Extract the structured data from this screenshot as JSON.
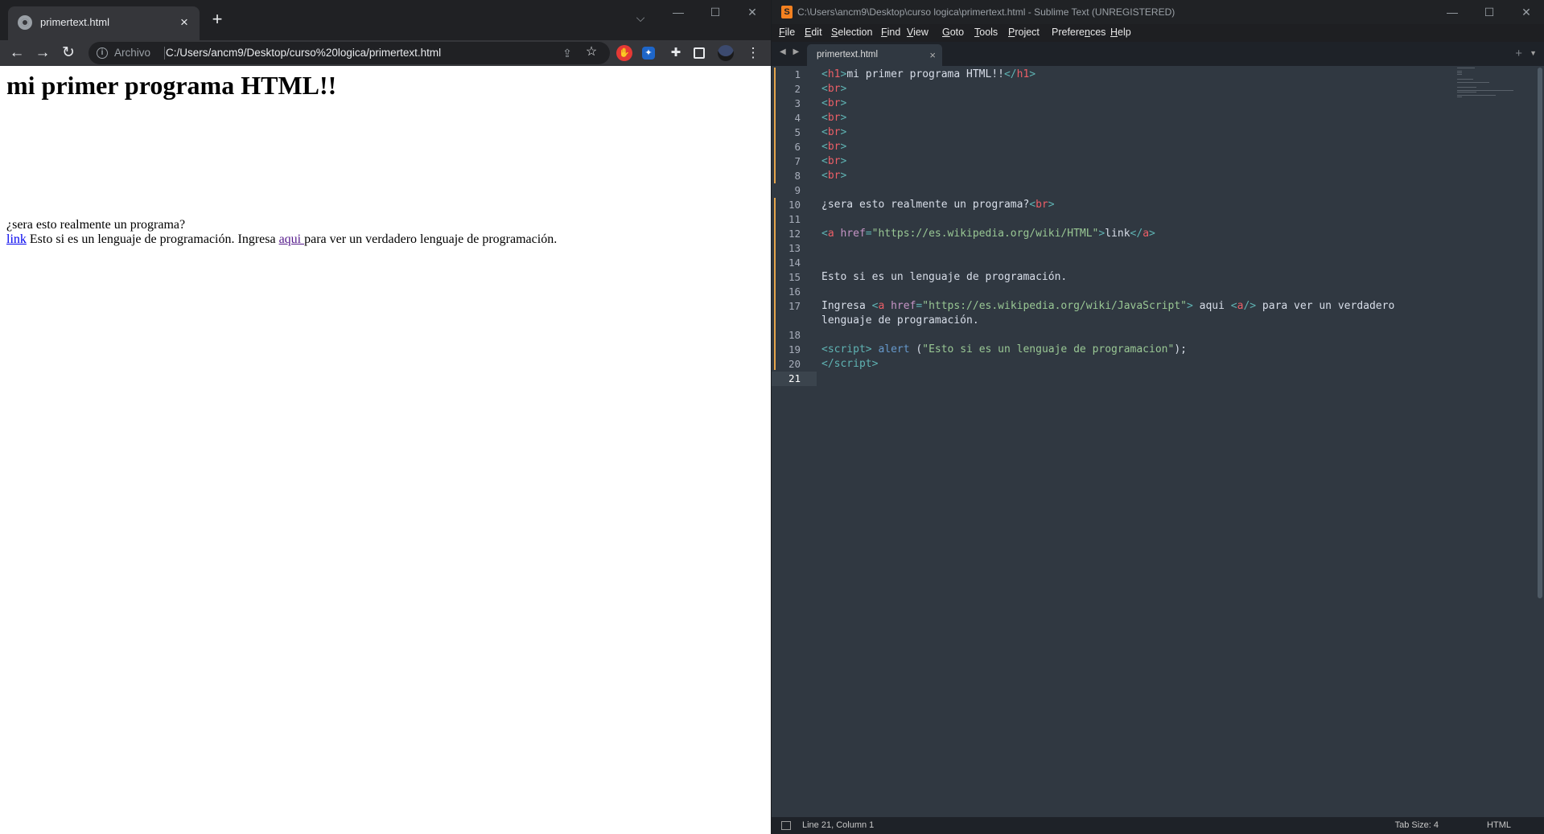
{
  "chrome": {
    "tab_title": "primertext.html",
    "tab_close": "×",
    "new_tab": "+",
    "tab_search": "⌵",
    "window_controls": {
      "minimize": "—",
      "maximize": "☐",
      "close": "✕"
    },
    "nav": {
      "back": "←",
      "forward": "→",
      "reload": "↻"
    },
    "omnibox": {
      "chip": "Archivo",
      "url": "C:/Users/ancm9/Desktop/curso%20logica/primertext.html",
      "share": "⇪",
      "star": "☆"
    },
    "menu": "⋮",
    "page": {
      "heading": "mi primer programa HTML!!",
      "line1": "¿sera esto realmente un programa?",
      "link1": "link",
      "text_a": " Esto si es un lenguaje de programación. Ingresa ",
      "link2": "aqui ",
      "text_b": "para ver un verdadero lenguaje de programación."
    }
  },
  "sublime": {
    "title": "C:\\Users\\ancm9\\Desktop\\curso logica\\primertext.html - Sublime Text (UNREGISTERED)",
    "logo": "S",
    "window_controls": {
      "minimize": "—",
      "maximize": "☐",
      "close": "✕"
    },
    "menu": [
      {
        "u": "F",
        "rest": "ile"
      },
      {
        "u": "E",
        "rest": "dit"
      },
      {
        "u": "S",
        "rest": "election"
      },
      {
        "u": "F",
        "rest": "ind"
      },
      {
        "u": "V",
        "rest": "iew"
      },
      {
        "u": "G",
        "rest": "oto"
      },
      {
        "u": "T",
        "rest": "ools"
      },
      {
        "u": "P",
        "rest": "roject"
      },
      {
        "pre": "Prefere",
        "u": "n",
        "rest": "ces"
      },
      {
        "u": "H",
        "rest": "elp"
      }
    ],
    "tab": {
      "label": "primertext.html",
      "close": "×"
    },
    "tab_nav": "◀ ▶",
    "tab_plus": "+",
    "tab_menu": "▼",
    "line_numbers": [
      "1",
      "2",
      "3",
      "4",
      "5",
      "6",
      "7",
      "8",
      "9",
      "10",
      "11",
      "12",
      "13",
      "14",
      "15",
      "16",
      "17",
      "18",
      "19",
      "20",
      "21"
    ],
    "code": {
      "l1": [
        "<",
        "h1",
        ">",
        "mi primer programa HTML!!",
        "</",
        "h1",
        ">"
      ],
      "br": [
        "<",
        "br",
        ">"
      ],
      "l10": [
        "¿sera esto realmente un programa?",
        "<",
        "br",
        ">"
      ],
      "l12": [
        "<",
        "a",
        " href",
        "=",
        "\"https://es.wikipedia.org/wiki/HTML\"",
        ">",
        "link",
        "</",
        "a",
        ">"
      ],
      "l15": "Esto si es un lenguaje de programación.",
      "l17": [
        "Ingresa ",
        "<",
        "a",
        " href",
        "=",
        "\"https://es.wikipedia.org/wiki/JavaScript\"",
        ">",
        " aqui ",
        "<",
        "a",
        "/>",
        " para ver un verdadero"
      ],
      "l17_wrap": "lenguaje de programación.",
      "l19": [
        "<",
        "script",
        ">",
        " ",
        "alert",
        " (",
        "\"Esto si es un lenguaje de programacion\"",
        ");"
      ],
      "l20": [
        "</",
        "script",
        ">"
      ]
    },
    "status": {
      "position": "Line 21, Column 1",
      "tab_size": "Tab Size: 4",
      "syntax": "HTML"
    }
  }
}
